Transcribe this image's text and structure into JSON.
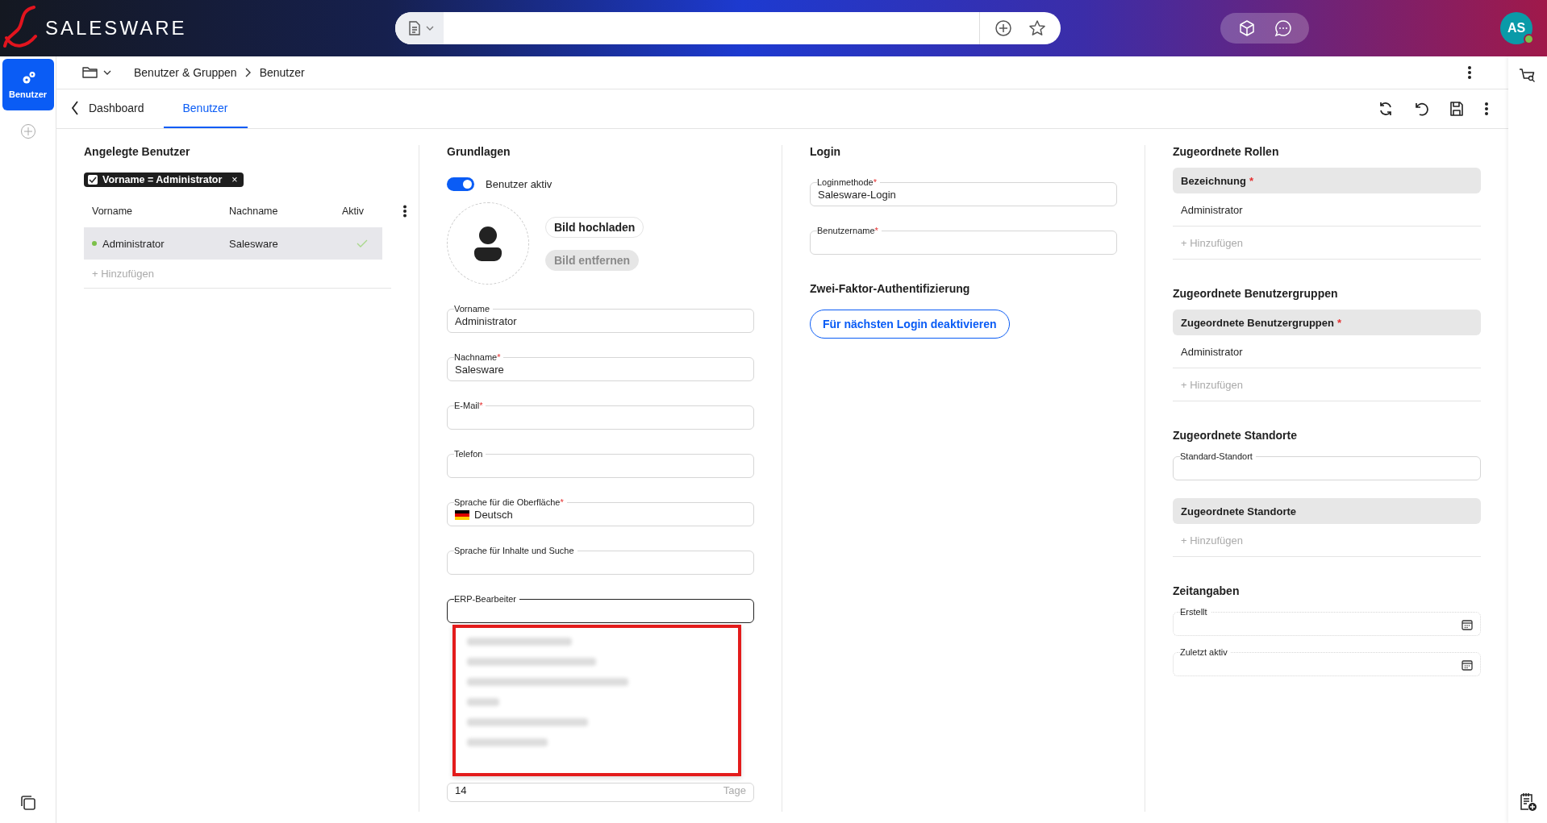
{
  "top_bar": {
    "logo": "SALESWARE",
    "avatar": "AS",
    "online": true
  },
  "rail": {
    "items": [
      {
        "label": "Benutzer",
        "selected": true
      }
    ]
  },
  "breadcrumb": [
    "Benutzer & Gruppen",
    "Benutzer"
  ],
  "tabs": [
    {
      "label": "Dashboard",
      "kind": "back",
      "selected": false
    },
    {
      "label": "Benutzer",
      "kind": "tab",
      "selected": true
    }
  ],
  "users_panel": {
    "title": "Angelegte Benutzer",
    "filter_chip": {
      "label": "Vorname = Administrator",
      "checked": true,
      "remove": "×"
    },
    "columns": [
      "Vorname",
      "Nachname",
      "Aktiv"
    ],
    "rows": [
      {
        "first_name": "Administrator",
        "last_name": "Salesware",
        "active": true,
        "online": true,
        "selected": true
      }
    ],
    "add_label": "+ Hinzufügen"
  },
  "basics": {
    "title": "Grundlagen",
    "active_toggle": {
      "label": "Benutzer aktiv",
      "on": true
    },
    "upload_button": "Bild hochladen",
    "remove_button": {
      "label": "Bild entfernen",
      "disabled": true
    },
    "fields": [
      {
        "kind": "text",
        "label": "Vorname",
        "value": "Administrator"
      },
      {
        "kind": "text",
        "label": "Nachname",
        "required": "*",
        "value": "Salesware"
      },
      {
        "kind": "text",
        "label": "E-Mail",
        "required": "*"
      },
      {
        "kind": "text",
        "label": "Telefon"
      },
      {
        "kind": "language",
        "label": "Sprache für die Oberfläche",
        "required": "*",
        "value": "Deutsch"
      },
      {
        "kind": "text",
        "label": "Sprache für Inhalte und Suche"
      },
      {
        "kind": "select",
        "label": "ERP-Bearbeiter",
        "focused": true,
        "open": true
      }
    ],
    "due_field": {
      "value": "14",
      "suffix": "Tage"
    }
  },
  "login": {
    "title": "Login",
    "fields": [
      {
        "label": "Loginmethode",
        "required": "*",
        "value": "Salesware-Login"
      },
      {
        "label": "Benutzername",
        "required": "*"
      }
    ],
    "two_factor": {
      "title": "Zwei-Faktor-Authentifizierung",
      "button": "Für nächsten Login deaktivieren"
    }
  },
  "assignments": [
    {
      "kind": "table",
      "title": "Zugeordnete Rollen",
      "header": "Bezeichnung",
      "required": "*",
      "rows": [
        "Administrator"
      ],
      "add_label": "+ Hinzufügen"
    },
    {
      "kind": "table",
      "title": "Zugeordnete Benutzergruppen",
      "header": "Zugeordnete Benutzergruppen",
      "required": "*",
      "rows": [
        "Administrator"
      ],
      "add_label": "+ Hinzufügen"
    },
    {
      "kind": "locations",
      "title": "Zugeordnete Standorte",
      "field": {
        "label": "Standard-Standort"
      },
      "header": "Zugeordnete Standorte",
      "add_label": "+ Hinzufügen"
    },
    {
      "kind": "dates",
      "title": "Zeitangaben",
      "fields": [
        {
          "label": "Erstellt"
        },
        {
          "label": "Zuletzt aktiv"
        }
      ]
    }
  ]
}
